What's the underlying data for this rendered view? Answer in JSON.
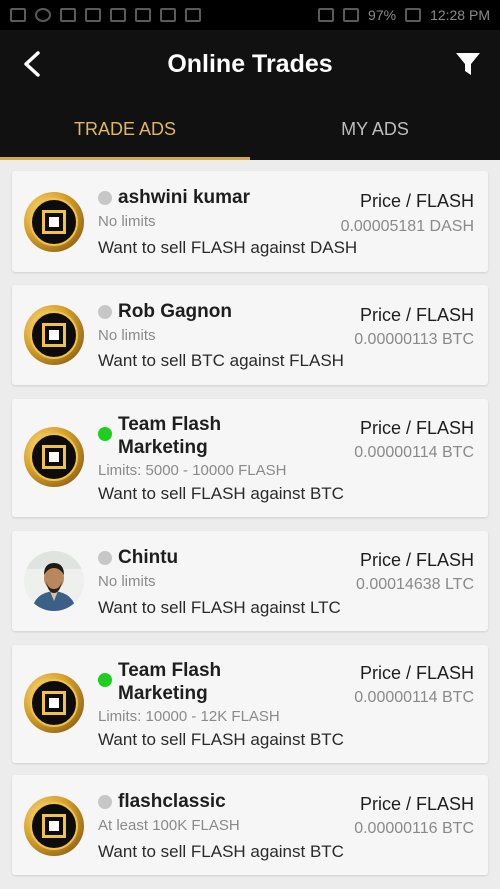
{
  "status_bar": {
    "battery": "97%",
    "time": "12:28 PM"
  },
  "app_bar": {
    "title": "Online Trades",
    "back_icon": "back-arrow-icon",
    "filter_icon": "filter-funnel-icon"
  },
  "tabs": [
    {
      "label": "TRADE ADS",
      "active": true
    },
    {
      "label": "MY ADS",
      "active": false
    }
  ],
  "colors": {
    "accent": "#d4a94b",
    "online": "#1ecf1e",
    "offline": "#c7c7c7",
    "bar": "#111111"
  },
  "trades": [
    {
      "name": "ashwini kumar",
      "status": "offline",
      "limits": "No limits",
      "description": "Want to sell FLASH against DASH",
      "price_label": "Price / FLASH",
      "price": "0.00005181 DASH",
      "avatar": "flash-coin-icon"
    },
    {
      "name": "Rob Gagnon",
      "status": "offline",
      "limits": "No limits",
      "description": "Want to sell BTC against FLASH",
      "price_label": "Price / FLASH",
      "price": "0.00000113 BTC",
      "avatar": "flash-coin-icon"
    },
    {
      "name": "Team Flash Marketing",
      "status": "online",
      "limits": "Limits: 5000 - 10000 FLASH",
      "description": "Want to sell FLASH against BTC",
      "price_label": "Price / FLASH",
      "price": "0.00000114 BTC",
      "avatar": "flash-coin-icon"
    },
    {
      "name": "Chintu",
      "status": "offline",
      "limits": "No limits",
      "description": "Want to sell FLASH against LTC",
      "price_label": "Price / FLASH",
      "price": "0.00014638 LTC",
      "avatar": "user-photo"
    },
    {
      "name": "Team Flash Marketing",
      "status": "online",
      "limits": "Limits: 10000 - 12K FLASH",
      "description": "Want to sell FLASH against BTC",
      "price_label": "Price / FLASH",
      "price": "0.00000114 BTC",
      "avatar": "flash-coin-icon"
    },
    {
      "name": "flashclassic",
      "status": "offline",
      "limits": "At least 100K FLASH",
      "description": "Want to sell FLASH against BTC",
      "price_label": "Price / FLASH",
      "price": "0.00000116 BTC",
      "avatar": "flash-coin-icon"
    }
  ]
}
